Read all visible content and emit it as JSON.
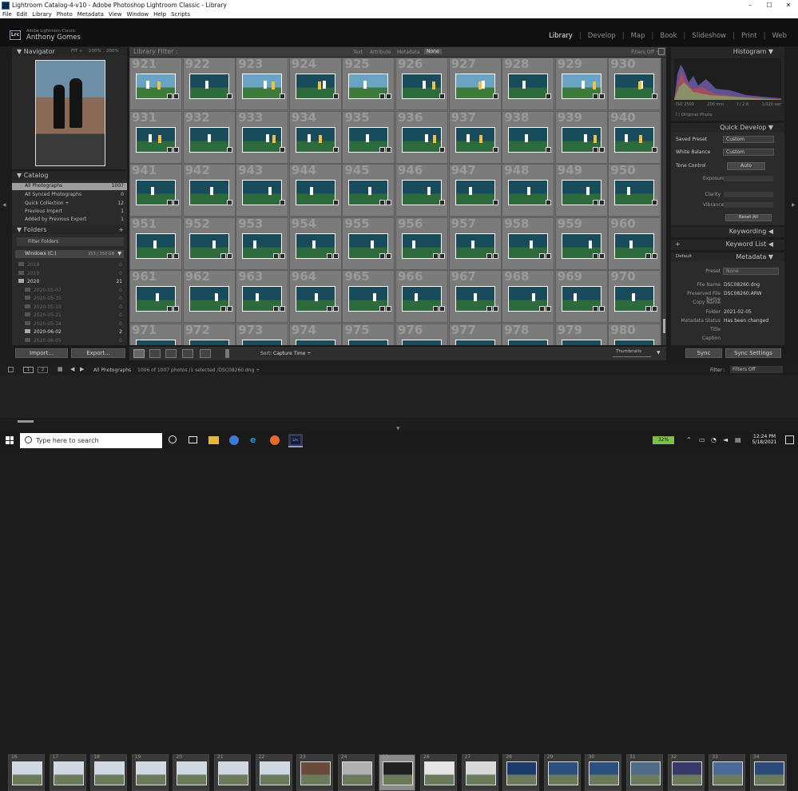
{
  "titlebar": {
    "title": "Lightroom Catalog-4-v10 - Adobe Photoshop Lightroom Classic - Library",
    "minimize": "–",
    "maximize": "☐",
    "close": "✕"
  },
  "menu": [
    "File",
    "Edit",
    "Library",
    "Photo",
    "Metadata",
    "View",
    "Window",
    "Help",
    "Scripts"
  ],
  "identity": {
    "badge": "Lrc",
    "brand": "Adobe Lightroom Classic",
    "user": "Anthony Gomes"
  },
  "modules": [
    "Library",
    "Develop",
    "Map",
    "Book",
    "Slideshow",
    "Print",
    "Web"
  ],
  "active_module": "Library",
  "navigator": {
    "title": "Navigator",
    "fit": "FIT ÷",
    "z100": "100%",
    "z200": "200%"
  },
  "catalog": {
    "title": "Catalog",
    "items": [
      {
        "label": "All Photographs",
        "count": "1007"
      },
      {
        "label": "All Synced Photographs",
        "count": "0"
      },
      {
        "label": "Quick Collection +",
        "count": "12"
      },
      {
        "label": "Previous Import",
        "count": "1"
      },
      {
        "label": "Added by Previous Export",
        "count": "1"
      }
    ]
  },
  "folders": {
    "title": "Folders",
    "add": "+",
    "filter_placeholder": "Filter Folders",
    "volume": "Windows (C:)",
    "volume_size": "353 / 350 GB",
    "items": [
      {
        "label": "2018",
        "count": "0"
      },
      {
        "label": "2019",
        "count": "0"
      },
      {
        "label": "2020",
        "count": "21"
      },
      {
        "label": "2020-05-07",
        "count": "0"
      },
      {
        "label": "2020-05-15",
        "count": "0"
      },
      {
        "label": "2020-05-19",
        "count": "0"
      },
      {
        "label": "2020-05-21",
        "count": "0"
      },
      {
        "label": "2020-05-24",
        "count": "0"
      },
      {
        "label": "2020-06-02",
        "count": "2"
      },
      {
        "label": "2020-06-05",
        "count": "0"
      }
    ]
  },
  "import_label": "Import...",
  "export_label": "Export...",
  "library_filter": {
    "title": "Library Filter :",
    "text": "Text",
    "attribute": "Attribute",
    "metadata": "Metadata",
    "none": "None",
    "filters_off": "Filters Off ÷"
  },
  "grid": {
    "rows": [
      [
        "921",
        "922",
        "923",
        "924",
        "925",
        "926",
        "927",
        "928",
        "929",
        "930"
      ],
      [
        "931",
        "932",
        "933",
        "934",
        "935",
        "936",
        "937",
        "938",
        "939",
        "940"
      ],
      [
        "941",
        "942",
        "943",
        "944",
        "945",
        "946",
        "947",
        "948",
        "949",
        "950"
      ],
      [
        "951",
        "952",
        "953",
        "954",
        "955",
        "956",
        "957",
        "958",
        "959",
        "960"
      ],
      [
        "961",
        "962",
        "963",
        "964",
        "965",
        "966",
        "967",
        "968",
        "969",
        "970"
      ],
      [
        "971",
        "972",
        "973",
        "974",
        "975",
        "976",
        "977",
        "978",
        "979",
        "980"
      ]
    ]
  },
  "toolbar": {
    "sort_label": "Sort:",
    "sort_value": "Capture Time ÷",
    "thumbnails": "Thumbnails"
  },
  "histogram": {
    "title": "Histogram",
    "iso": "ISO 2500",
    "focal": "200 mm",
    "fstop": "f / 2.8",
    "shutter": "1/320 sec",
    "original": "Original Photo"
  },
  "quick_develop": {
    "title": "Quick Develop",
    "saved_preset_label": "Saved Preset",
    "saved_preset_value": "Custom",
    "wb_label": "White Balance",
    "wb_value": "Custom",
    "tone_label": "Tone Control",
    "auto": "Auto",
    "exposure": "Exposure",
    "clarity": "Clarity",
    "vibrance": "Vibrance",
    "reset": "Reset All"
  },
  "keywording": {
    "title": "Keywording"
  },
  "keyword_list": {
    "title": "Keyword List",
    "add": "+"
  },
  "metadata": {
    "title": "Metadata",
    "default": "Default",
    "preset_label": "Preset",
    "preset_value": "None",
    "fields": [
      {
        "label": "File Name",
        "value": "DSC08260.dng"
      },
      {
        "label": "Preserved File Name",
        "value": "DSC08260.ARW"
      },
      {
        "label": "Copy Name",
        "value": ""
      },
      {
        "label": "Folder",
        "value": "2021-02-05"
      },
      {
        "label": "Metadata Status",
        "value": "Has been changed"
      },
      {
        "label": "Title",
        "value": ""
      },
      {
        "label": "Caption",
        "value": ""
      }
    ]
  },
  "sync_label": "Sync",
  "sync_settings_label": "Sync Settings",
  "filmstrip": {
    "source": "All Photographs",
    "info": "1006 of 1007 photos /1 selected /DSC08260.dng ÷",
    "filter_label": "Filter :",
    "filter_value": "Filters Off",
    "frames": [
      "16",
      "17",
      "18",
      "19",
      "20",
      "21",
      "22",
      "23",
      "24",
      "25",
      "26",
      "27",
      "28",
      "29",
      "30",
      "31",
      "32",
      "33",
      "34"
    ]
  },
  "taskbar": {
    "search_placeholder": "Type here to search",
    "battery": "32%",
    "time": "12:24 PM",
    "date": "5/18/2021"
  }
}
